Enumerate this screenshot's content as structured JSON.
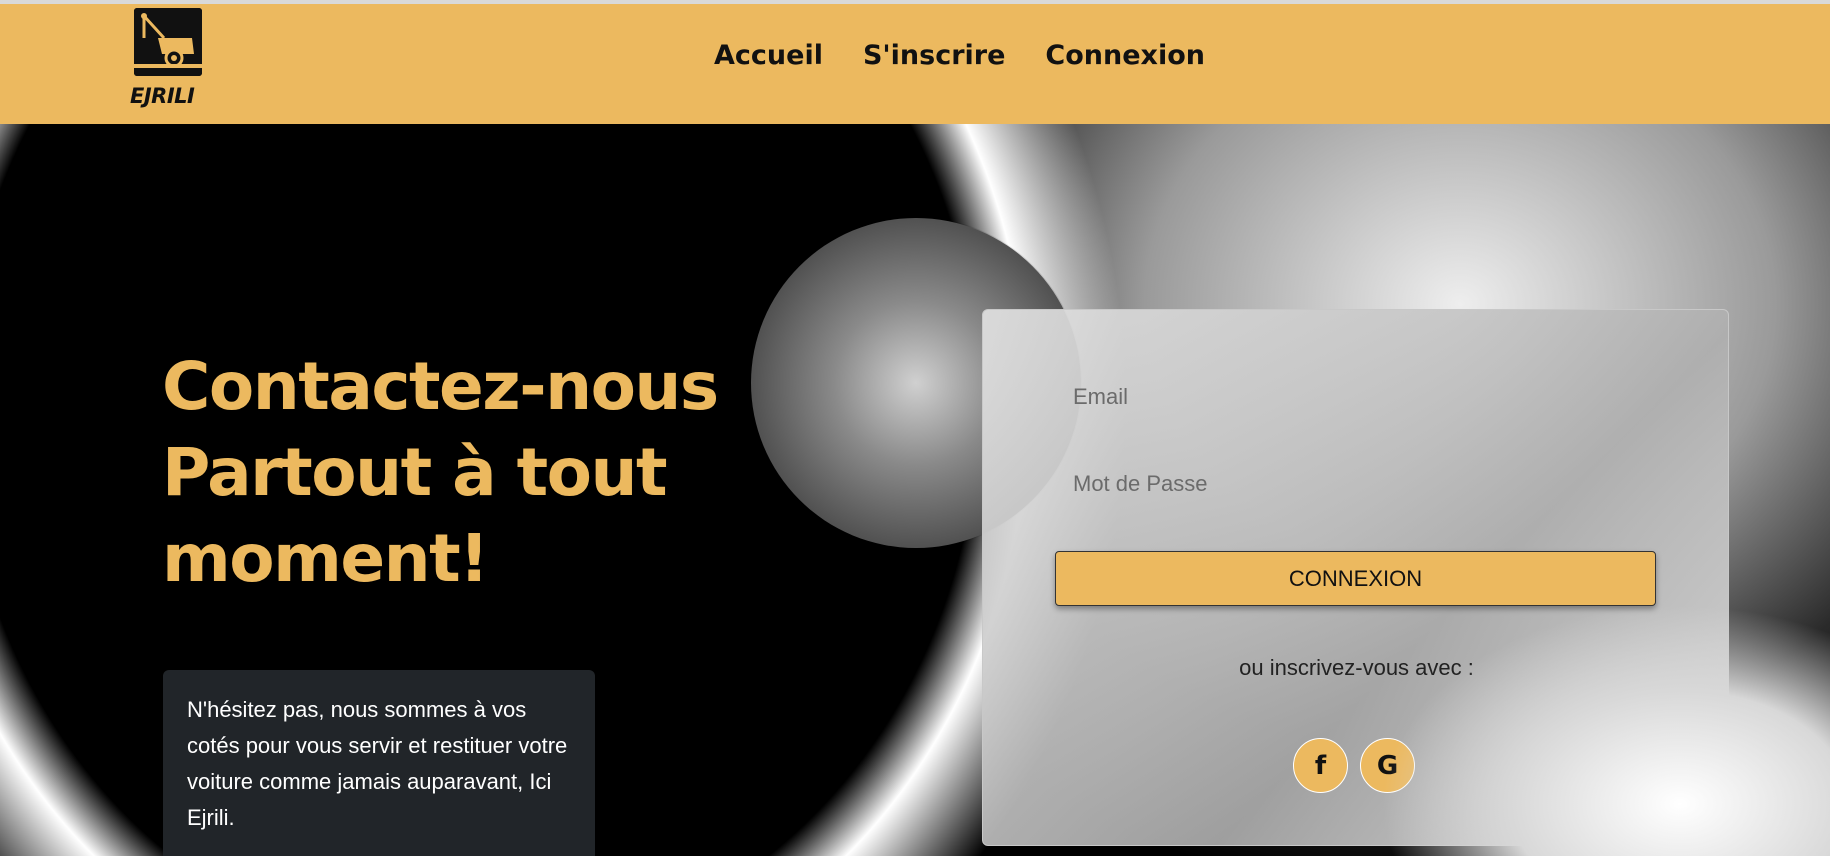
{
  "brand": {
    "name": "EJRILI",
    "logo_icon": "tow-truck-icon",
    "accent_color": "#ecb95f"
  },
  "nav": {
    "items": [
      {
        "label": "Accueil"
      },
      {
        "label": "S'inscrire"
      },
      {
        "label": "Connexion"
      }
    ]
  },
  "hero": {
    "headline_lines": [
      "Contactez-nous",
      "Partout à tout",
      "moment!"
    ],
    "info_text": "N'hésitez pas, nous sommes à vos cotés pour vous servir et restituer votre voiture comme jamais auparavant, Ici Ejrili."
  },
  "login": {
    "email_placeholder": "Email",
    "password_placeholder": "Mot de Passe",
    "submit_label": "CONNEXION",
    "alt_signup_text": "ou inscrivez-vous avec :",
    "social": [
      {
        "icon": "facebook-icon",
        "glyph": "f"
      },
      {
        "icon": "google-icon",
        "glyph": "G"
      }
    ]
  }
}
